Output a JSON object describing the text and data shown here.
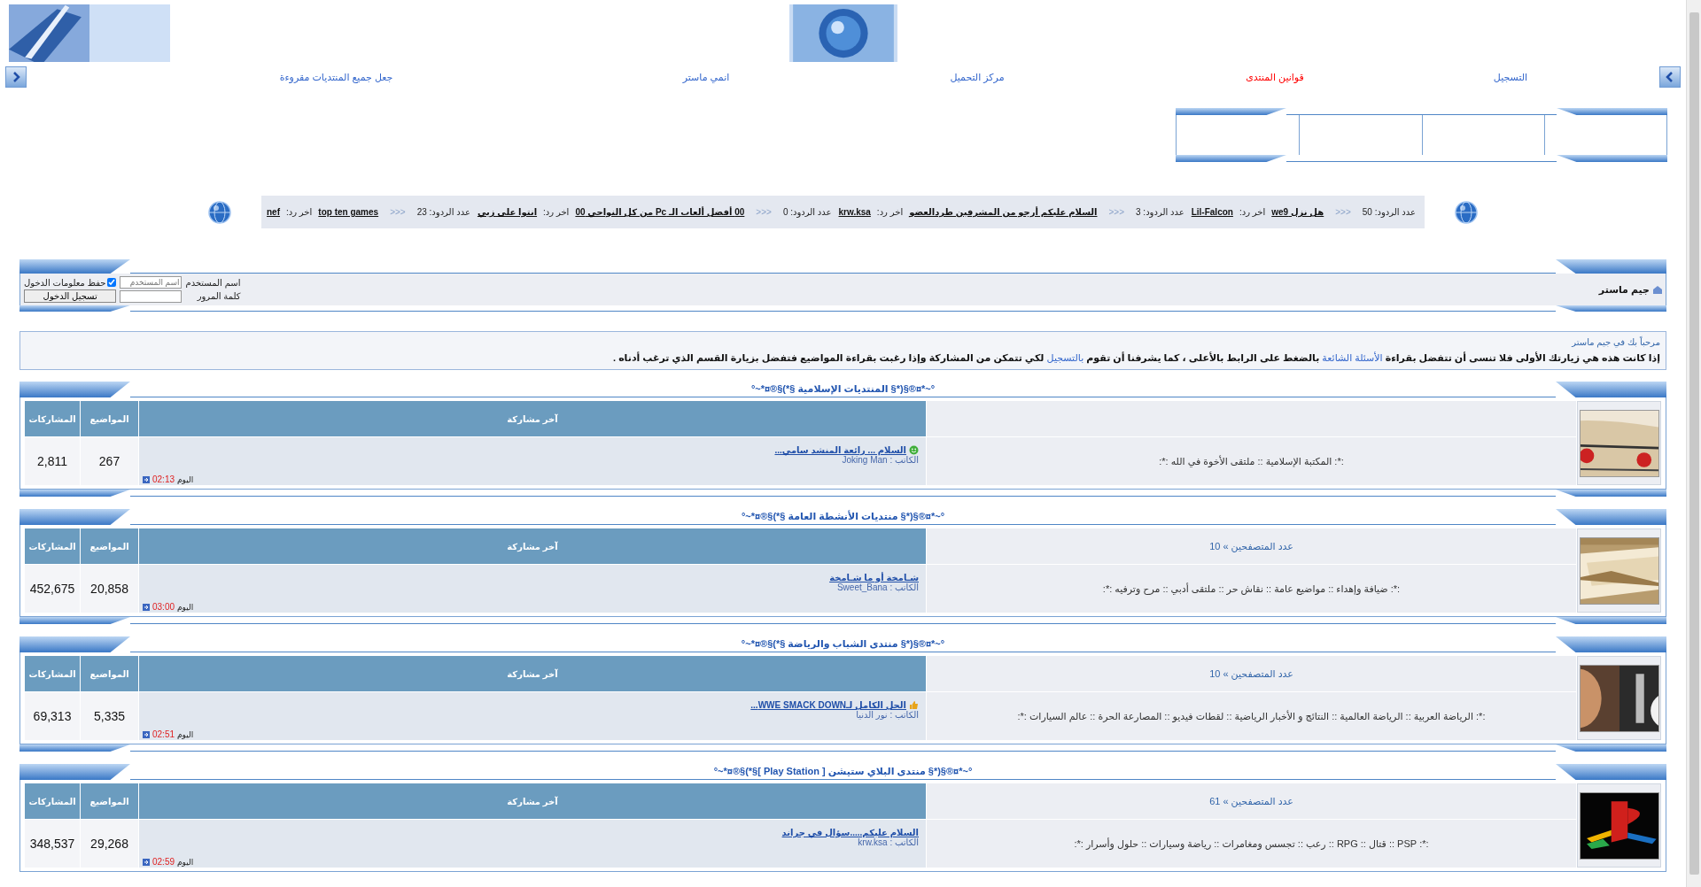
{
  "nav": [
    {
      "label": "التسجيل",
      "color": "#3366cc"
    },
    {
      "label": "قوانين المنتدى",
      "color": "#ff0000"
    },
    {
      "label": "مركز التحميل",
      "color": "#3366cc"
    },
    {
      "label": "انمي ماستر",
      "color": "#3366cc"
    },
    {
      "label": "جعل جميع المنتديات مقروءة",
      "color": "#3366cc"
    }
  ],
  "ticker": [
    {
      "replies": "عدد الردود: 50",
      "sep": "<<<",
      "title": "هل نزل we9",
      "last_label": "اخر رد:",
      "last_by": "Lil-Falcon"
    },
    {
      "replies": "عدد الردود: 3",
      "sep": "<<<",
      "title": "السلام عليكم أرجو من المشرفين طردالعضو",
      "last_label": "اخر رد:",
      "last_by": "krw.ksa"
    },
    {
      "replies": "عدد الردود: 0",
      "sep": "<<<",
      "title": "00 أفضل ألعاب الـ Pc من كل النواحي 00",
      "last_label": "اخر رد:",
      "last_by": "انتوا على زيي"
    },
    {
      "replies": "عدد الردود: 23",
      "sep": "<<<",
      "title": "top ten games",
      "last_label": "اخر رد:",
      "last_by": "nef"
    }
  ],
  "login": {
    "site_name": "جيم ماستر",
    "username_label": "اسم المستخدم",
    "username_placeholder": "اسم المستخدم",
    "remember_label": "حفظ معلومات الدخول",
    "remember_checked": true,
    "password_label": "كلمة المرور",
    "submit": "تسجيل الدخول"
  },
  "welcome": {
    "greeting": "مرحباً بك في جيم ماستر",
    "message": [
      {
        "text": "إذا كانت هذه هي زيارتك الأولى فلا تنسى أن تتفضل بقراءة ",
        "kind": "text"
      },
      {
        "text": "الأسئلة الشائعة",
        "kind": "link"
      },
      {
        "text": " بالضغط على الرابط بالأعلى ، كما يشرفنا أن تقوم ",
        "kind": "text"
      },
      {
        "text": "بالتسجيل",
        "kind": "link"
      },
      {
        "text": " لكي تتمكن من المشاركة وإذا رغبت بقراءة المواضيع فتفضل بزيارة القسم الذي ترغب أدناه .",
        "kind": "text"
      }
    ]
  },
  "sections": [
    {
      "title": "°~*¤®§(*§ المنتديات الإسلامية §*)§®¤*~°",
      "columns": {
        "last_post": "آخر مشاركة",
        "topics": "المواضيع",
        "posts": "المشاركات"
      },
      "description": ":*: المكتبة الإسلامية :: ملتقى الأخوة في الله :*:",
      "last_post": {
        "kind": "smile",
        "title": "السلام ... رائعة المنشد سامي...",
        "author_label": "الكاتب :",
        "author": "Joking Man",
        "day": "اليوم",
        "time": "02:13"
      },
      "topics": "267",
      "posts": "2,811"
    },
    {
      "title": "°~*¤®§(*§ منتديات الأنشطة العامة §*)§®¤*~°",
      "viewers": "عدد المتصفحين » 10",
      "columns": {
        "last_post": "آخر مشاركة",
        "topics": "المواضيع",
        "posts": "المشاركات"
      },
      "description": ":*: ضيافة وإهداء :: مواضيع عامة :: نقاش حر :: ملتقى أدبي :: مرح وترفيه :*:",
      "last_post": {
        "title": "شـامخة أو ما شـامخة",
        "author_label": "الكاتب :",
        "author": "Sweet_Bana",
        "day": "اليوم",
        "time": "03:00"
      },
      "topics": "20,858",
      "posts": "452,675"
    },
    {
      "title": "°~*¤®§(*§ منتدى الشباب والرياضة §*)§®¤*~°",
      "viewers": "عدد المتصفحين » 10",
      "columns": {
        "last_post": "آخر مشاركة",
        "topics": "المواضيع",
        "posts": "المشاركات"
      },
      "description": ":*: الرياضة العربية :: الرياضة العالمية :: النتائج و الأخبار الرياضية :: لقطات فيديو :: المصارعة الحرة :: عالم السيارات :*:",
      "last_post": {
        "kind": "thumb",
        "title": "الحل الكامل لـWWE SMACK DOWN...",
        "author_label": "الكاتب :",
        "author": "نور الدنيا",
        "day": "اليوم",
        "time": "02:51"
      },
      "topics": "5,335",
      "posts": "69,313"
    },
    {
      "title": "°~*¤®§(*§ منتدى البلاي ستيشن [ Play Station ]§*)§®¤*~°",
      "viewers": "عدد المتصفحين » 61",
      "columns": {
        "last_post": "آخر مشاركة",
        "topics": "المواضيع",
        "posts": "المشاركات"
      },
      "description": ":*: PSP :: قتال :: RPG :: رعب :: تجسس ومغامرات :: رياضة وسيارات :: حلول وأسرار :*:",
      "last_post": {
        "title": "السلام عليكم.....سؤال في جراند",
        "author_label": "الكاتب :",
        "author": "krw.ksa",
        "day": "اليوم",
        "time": "02:59"
      },
      "topics": "29,268",
      "posts": "348,537"
    }
  ]
}
